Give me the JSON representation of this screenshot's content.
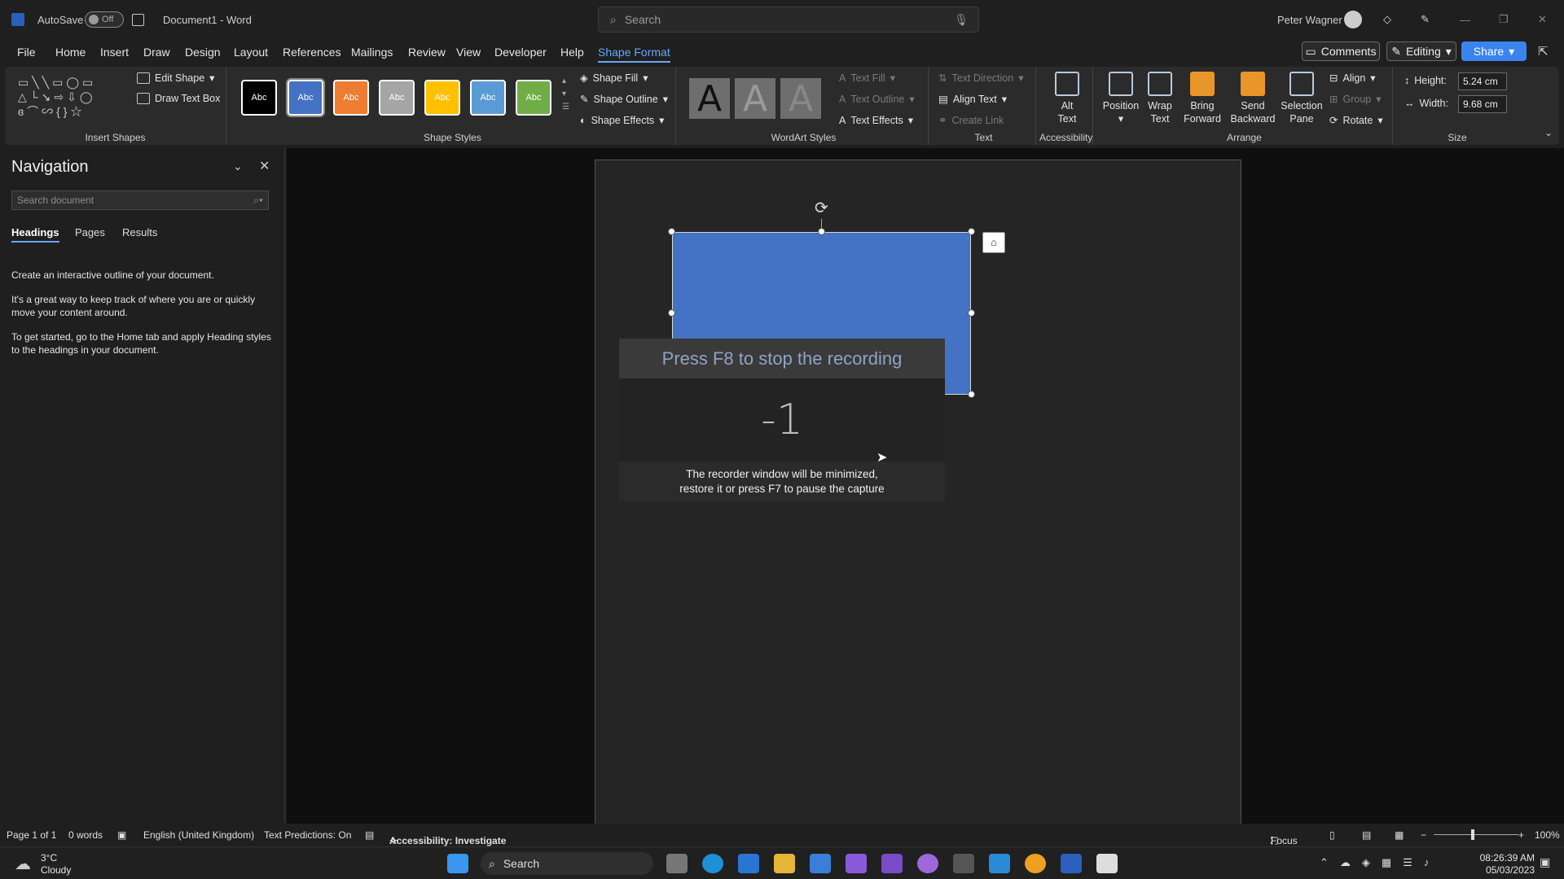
{
  "titlebar": {
    "autosave_label": "AutoSave",
    "autosave_state": "Off",
    "doc_title": "Document1 - Word",
    "search_placeholder": "Search",
    "user_name": "Peter Wagner"
  },
  "menu": {
    "items": [
      "File",
      "Home",
      "Insert",
      "Draw",
      "Design",
      "Layout",
      "References",
      "Mailings",
      "Review",
      "View",
      "Developer",
      "Help",
      "Shape Format"
    ],
    "comments_label": "Comments",
    "editing_label": "Editing",
    "share_label": "Share"
  },
  "ribbon": {
    "insert_shapes": {
      "edit_shape": "Edit Shape",
      "draw_text_box": "Draw Text Box",
      "label": "Insert Shapes"
    },
    "shape_styles": {
      "swatch_text": "Abc",
      "shape_fill": "Shape Fill",
      "shape_outline": "Shape Outline",
      "shape_effects": "Shape Effects",
      "label": "Shape Styles"
    },
    "wordart": {
      "glyph": "A",
      "text_fill": "Text Fill",
      "text_outline": "Text Outline",
      "text_effects": "Text Effects",
      "label": "WordArt Styles"
    },
    "text": {
      "text_direction": "Text Direction",
      "align_text": "Align Text",
      "create_link": "Create Link",
      "label": "Text"
    },
    "accessibility": {
      "alt_text_1": "Alt",
      "alt_text_2": "Text",
      "label": "Accessibility"
    },
    "arrange": {
      "position": "Position",
      "wrap_1": "Wrap",
      "wrap_2": "Text",
      "bring_1": "Bring",
      "bring_2": "Forward",
      "send_1": "Send",
      "send_2": "Backward",
      "sel_1": "Selection",
      "sel_2": "Pane",
      "align": "Align",
      "group": "Group",
      "rotate": "Rotate",
      "label": "Arrange"
    },
    "size": {
      "height_label": "Height:",
      "height_value": "5.24 cm",
      "width_label": "Width:",
      "width_value": "9.68 cm",
      "label": "Size"
    }
  },
  "navigation": {
    "title": "Navigation",
    "search_placeholder": "Search document",
    "tabs": [
      "Headings",
      "Pages",
      "Results"
    ],
    "paragraphs": [
      "Create an interactive outline of your document.",
      "It's a great way to keep track of where you are or quickly move your content around.",
      "To get started, go to the Home tab and apply Heading styles to the headings in your document."
    ]
  },
  "recorder": {
    "top_message": "Press F8 to stop the recording",
    "countdown": "-1",
    "line1": "The recorder window will be minimized,",
    "line2": "restore it or press F7 to pause the capture"
  },
  "status": {
    "page": "Page 1 of 1",
    "words": "0 words",
    "language": "English (United Kingdom)",
    "predictions": "Text Predictions: On",
    "accessibility": "Accessibility: Investigate",
    "focus": "Focus",
    "zoom": "100%"
  },
  "taskbar": {
    "temp": "3°C",
    "weather": "Cloudy",
    "search": "Search",
    "time": "08:26:39 AM",
    "date": "05/03/2023"
  },
  "colors": {
    "accent": "#69a7ff",
    "shape_fill": "#4472c4"
  }
}
